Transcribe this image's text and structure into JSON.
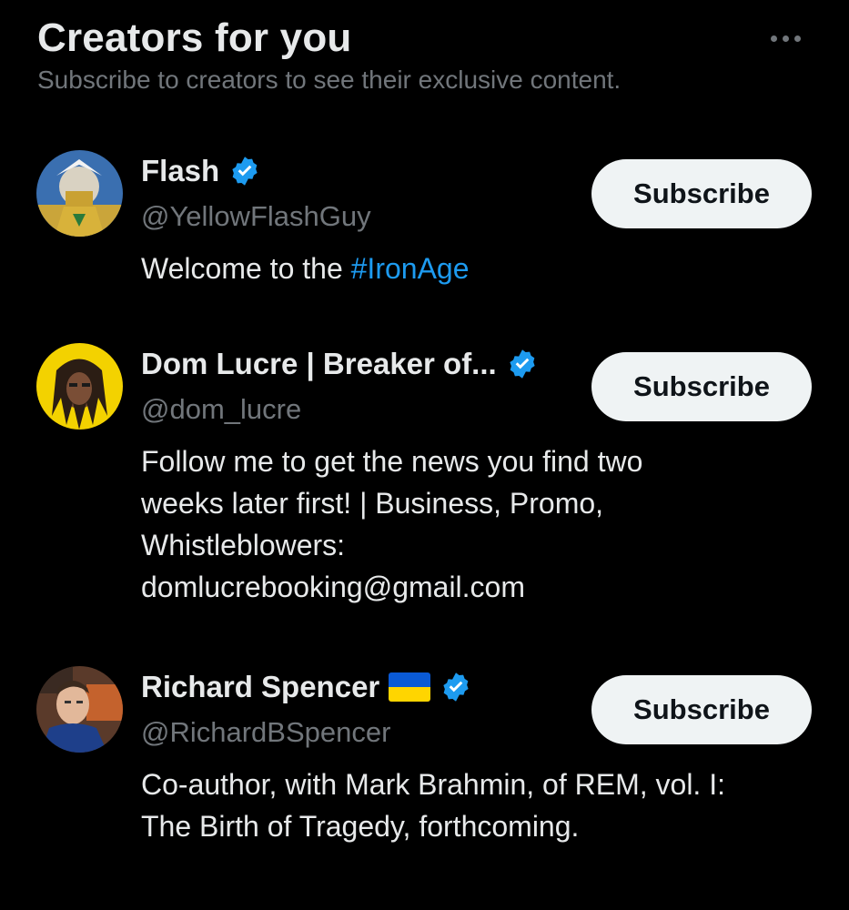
{
  "header": {
    "title": "Creators for you",
    "subtitle": "Subscribe to creators to see their exclusive content."
  },
  "colors": {
    "background": "#000000",
    "text_primary": "#e7e9ea",
    "text_secondary": "#71767b",
    "accent": "#1d9bf0",
    "button_bg": "#eff3f4"
  },
  "creators": [
    {
      "name": "Flash",
      "handle": "@YellowFlashGuy",
      "verified": true,
      "bio_prefix": "Welcome to the ",
      "bio_hashtag": "#IronAge",
      "subscribe_label": "Subscribe"
    },
    {
      "name": "Dom Lucre | Breaker of...",
      "handle": "@dom_lucre",
      "verified": true,
      "bio_lines": [
        "Follow me to get the news you find two",
        "weeks later first! | Business, Promo,",
        "Whistleblowers:",
        "domlucrebooking@gmail.com"
      ],
      "subscribe_label": "Subscribe"
    },
    {
      "name": "Richard Spencer",
      "handle": "@RichardBSpencer",
      "verified": true,
      "flag": "ukraine-flag-emoji",
      "bio_lines": [
        "Co-author, with Mark Brahmin, of REM, vol. I:",
        "The Birth of Tragedy, forthcoming."
      ],
      "subscribe_label": "Subscribe"
    }
  ]
}
